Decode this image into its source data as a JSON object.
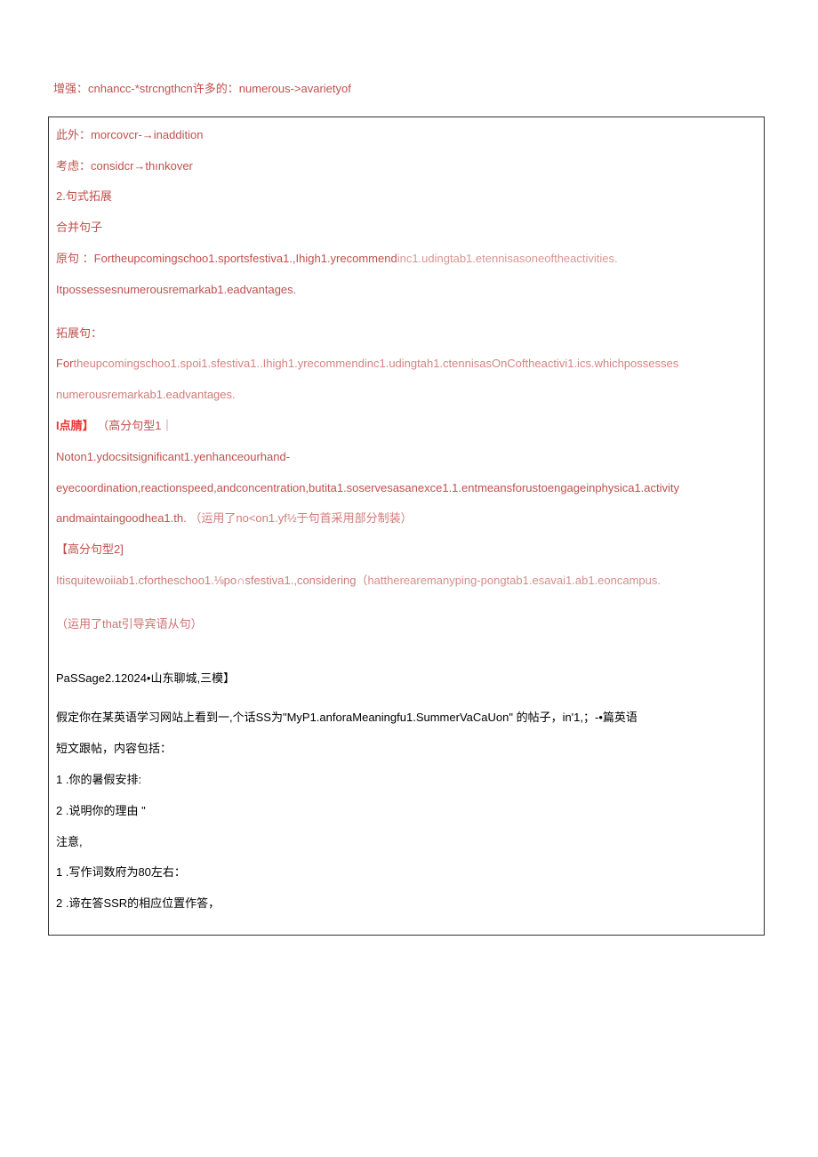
{
  "outer": {
    "synonyms1": "增强：cnhancc-*strcngthcn许多的：numerous->avarietyof"
  },
  "section1": {
    "syn_moreover": "此外：morcovcr-→inaddition",
    "syn_consider": "考虑：considcr→thınkover",
    "heading2": "2.句式拓展",
    "merge_label": "合并句子",
    "orig_label": "原句 ：",
    "orig_part1": "Fortheupcomingschoo1.sportsfestiva1.,Ihigh1.yrecommend",
    "orig_part2": "inc1.udingtab1.e",
    "orig_part3": "tennisasoneoftheactivities.",
    "orig_line2": "Itpossessesnumerousremarkab1.eadvantages.",
    "expand_label": "拓展句：",
    "expand_part1": "For",
    "expand_part2": "theupcomingschoo1.spoi1.sfestiva1..Ihigh1.yrecommendinc1.udingtah1.ctennisasOnCoftheactivi1.ics.whichpossesses",
    "expand_line2": "numerousremarkab1.eadvantages.",
    "dianjing_label": "I点腈】",
    "gaofen1_label": "（高分句型1｜",
    "gaofen1_line1": "Noton1.ydocsitsignificant1.yenhanceourhand-",
    "gaofen1_line2": "eyecoordination,reactionspeed,andconcentration,butita1.soservesasanexce1.1.entmeansforustoengageinphysica1.activity",
    "gaofen1_line3a": "andmaintaingoodhea1.th.",
    "gaofen1_line3b": "（运用了no<on1.yf½于句首采用部分制装）",
    "gaofen2_label": "【高分句型2]",
    "gaofen2_line1a": "Itisquitewoiiab1.cfortheschoo1.⅛po∩sfestiva1.,considering（",
    "gaofen2_line1b": "hattherearemanyping-pongtab1.esavai1.ab1.eoncampus.",
    "gaofen2_note": "（运用了that引导宾语从句）",
    "passage_title": "PaSSage2.12024•山东聊城,三模】",
    "prompt_line1": "假定你在某英语学习网站上看到一,个话SS为\"MyP1.anforaMeaningfu1.SummerVaCaUon\" 的帖子，in'1,；-•篇英语",
    "prompt_line2": "短文跟帖，内容包括：",
    "item1": "1 .你的暑假安排:",
    "item2": "2 .说明你的理由 \"",
    "note_label": "注意,",
    "note1": "1 .写作词数府为80左右：",
    "note2": "2 .谛在答SSR的相应位置作答，"
  }
}
